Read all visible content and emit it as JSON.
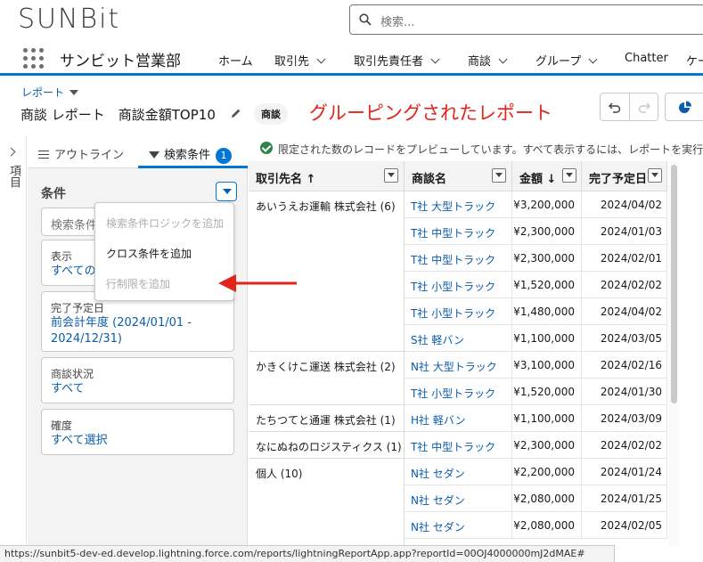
{
  "brand": {
    "logo": "SUNBit",
    "accent": "#0176d3"
  },
  "search": {
    "placeholder": "検索..."
  },
  "app": {
    "name": "サンビット営業部",
    "nav": [
      {
        "label": "ホーム"
      },
      {
        "label": "取引先"
      },
      {
        "label": "取引先責任者"
      },
      {
        "label": "商談"
      },
      {
        "label": "グループ"
      },
      {
        "label": "Chatter"
      },
      {
        "label": "ケー"
      }
    ]
  },
  "page": {
    "breadcrumb": "レポート",
    "title": "商談 レポート　商談金額TOP10",
    "object_badge": "商談",
    "annotation": "グルーピングされたレポート"
  },
  "left_strip": {
    "label": "項目"
  },
  "panel": {
    "tab_outline": "アウトライン",
    "tab_filters": "検索条件",
    "filter_count": "1",
    "conditions_heading": "条件",
    "search_placeholder": "検索条件",
    "filters": [
      {
        "label": "表示",
        "value": "すべての"
      },
      {
        "label": "完了予定日",
        "value_line1": "前会計年度 (2024/01/01 -",
        "value_line2": "2024/12/31)"
      },
      {
        "label": "商談状況",
        "value": "すべて"
      },
      {
        "label": "確度",
        "value": "すべて選択"
      }
    ]
  },
  "menu": {
    "items": [
      {
        "label": "検索条件ロジックを追加",
        "disabled": true
      },
      {
        "label": "クロス条件を追加",
        "disabled": false
      },
      {
        "label": "行制限を追加",
        "disabled": true
      }
    ]
  },
  "notice": "限定された数のレコードをプレビューしています。すべて表示するには、レポートを実行",
  "table": {
    "headers": [
      "取引先名 ↑",
      "商談名",
      "金額 ↓",
      "完了予定日"
    ],
    "groups": [
      {
        "account": "あいうえお運輸 株式会社 (6)",
        "rows": [
          [
            "T社 大型トラック",
            "¥3,200,000",
            "2024/04/02"
          ],
          [
            "T社 中型トラック",
            "¥2,300,000",
            "2024/01/03"
          ],
          [
            "T社 中型トラック",
            "¥2,300,000",
            "2024/02/01"
          ],
          [
            "T社 小型トラック",
            "¥1,520,000",
            "2024/02/02"
          ],
          [
            "T社 小型トラック",
            "¥1,480,000",
            "2024/04/02"
          ],
          [
            "S社 軽バン",
            "¥1,100,000",
            "2024/03/05"
          ]
        ]
      },
      {
        "account": "かきくけこ運送 株式会社 (2)",
        "rows": [
          [
            "N社 大型トラック",
            "¥3,100,000",
            "2024/02/16"
          ],
          [
            "T社 小型トラック",
            "¥1,520,000",
            "2024/01/30"
          ]
        ]
      },
      {
        "account": "たちつてと通運 株式会社 (1)",
        "rows": [
          [
            "H社 軽バン",
            "¥1,100,000",
            "2024/03/09"
          ]
        ]
      },
      {
        "account": "なにぬねのロジスティクス (1)",
        "rows": [
          [
            "T社 中型トラック",
            "¥2,300,000",
            "2024/02/02"
          ]
        ]
      },
      {
        "account": "個人 (10)",
        "rows": [
          [
            "N社 セダン",
            "¥2,200,000",
            "2024/01/24"
          ],
          [
            "N社 セダン",
            "¥2,080,000",
            "2024/01/25"
          ],
          [
            "N社 セダン",
            "¥2,080,000",
            "2024/02/05"
          ]
        ]
      }
    ]
  },
  "status_url": "https://sunbit5-dev-ed.develop.lightning.force.com/reports/lightningReportApp.app?reportId=00OJ4000000mJ2dMAE#"
}
